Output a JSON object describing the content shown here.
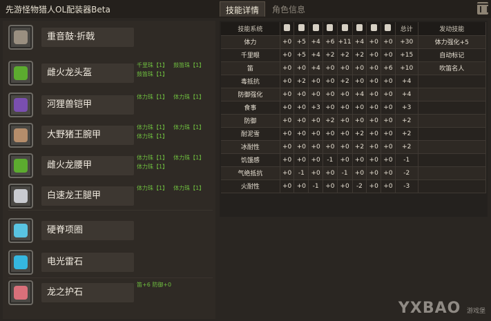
{
  "app": {
    "title": "先游怪物猎人OL配装器Beta"
  },
  "tabs": [
    {
      "label": "技能详情",
      "active": true
    },
    {
      "label": "角色信息",
      "active": false
    }
  ],
  "equipment": [
    {
      "name": "重音鼓·折戟",
      "icon": "weapon-drum-icon",
      "color": "#9a8f80",
      "decorations": []
    },
    {
      "name": "雌火龙头盔",
      "icon": "helm-icon",
      "color": "#5cab2f",
      "decorations": [
        "千里珠【1】",
        "鼓笛珠【1】",
        "鼓笛珠【1】"
      ]
    },
    {
      "name": "河狸兽铠甲",
      "icon": "chest-armor-icon",
      "color": "#7a4fb0",
      "decorations": [
        "体力珠【1】",
        "体力珠【1】"
      ]
    },
    {
      "name": "大野猪王腕甲",
      "icon": "gauntlet-icon",
      "color": "#b58d6b",
      "decorations": [
        "体力珠【1】",
        "体力珠【1】",
        "体力珠【1】"
      ]
    },
    {
      "name": "雌火龙腰甲",
      "icon": "waist-armor-icon",
      "color": "#5cab2f",
      "decorations": [
        "体力珠【1】",
        "体力珠【1】",
        "体力珠【1】"
      ]
    },
    {
      "name": "白速龙王腿甲",
      "icon": "leg-armor-icon",
      "color": "#c9cbd0",
      "decorations": [
        "体力珠【1】",
        "体力珠【1】"
      ]
    },
    {
      "name": "硬脊项圈",
      "icon": "necklace-icon",
      "color": "#59c4e2",
      "decorations": []
    },
    {
      "name": "电光雷石",
      "icon": "gem-icon",
      "color": "#35b7e0",
      "decorations": []
    },
    {
      "name": "龙之护石",
      "icon": "charm-icon",
      "color": "#d9707a",
      "decorations": [
        "笛+6  防御+0"
      ]
    }
  ],
  "table": {
    "header_first": "技能系统",
    "part_icons": [
      "weapon-icon",
      "helm-icon",
      "chest-icon",
      "arm-icon",
      "waist-icon",
      "leg-icon",
      "necklace-icon",
      "charm-icon"
    ],
    "header_total": "总计",
    "header_active": "发动技能",
    "rows": [
      {
        "name": "体力",
        "values": [
          "+0",
          "+5",
          "+4",
          "+6",
          "+11",
          "+4",
          "+0",
          "+0"
        ],
        "total": "+30",
        "active": "体力强化+5"
      },
      {
        "name": "千里眼",
        "values": [
          "+0",
          "+5",
          "+4",
          "+2",
          "+2",
          "+2",
          "+0",
          "+0"
        ],
        "total": "+15",
        "active": "自动标记"
      },
      {
        "name": "笛",
        "values": [
          "+0",
          "+0",
          "+4",
          "+0",
          "+0",
          "+0",
          "+0",
          "+6"
        ],
        "total": "+10",
        "active": "吹笛名人"
      },
      {
        "name": "毒抵抗",
        "values": [
          "+0",
          "+2",
          "+0",
          "+0",
          "+2",
          "+0",
          "+0",
          "+0"
        ],
        "total": "+4",
        "active": ""
      },
      {
        "name": "防御强化",
        "values": [
          "+0",
          "+0",
          "+0",
          "+0",
          "+0",
          "+4",
          "+0",
          "+0"
        ],
        "total": "+4",
        "active": ""
      },
      {
        "name": "食事",
        "values": [
          "+0",
          "+0",
          "+3",
          "+0",
          "+0",
          "+0",
          "+0",
          "+0"
        ],
        "total": "+3",
        "active": ""
      },
      {
        "name": "防御",
        "values": [
          "+0",
          "+0",
          "+0",
          "+2",
          "+0",
          "+0",
          "+0",
          "+0"
        ],
        "total": "+2",
        "active": ""
      },
      {
        "name": "耐泥雪",
        "values": [
          "+0",
          "+0",
          "+0",
          "+0",
          "+0",
          "+2",
          "+0",
          "+0"
        ],
        "total": "+2",
        "active": ""
      },
      {
        "name": "冰耐性",
        "values": [
          "+0",
          "+0",
          "+0",
          "+0",
          "+0",
          "+2",
          "+0",
          "+0"
        ],
        "total": "+2",
        "active": ""
      },
      {
        "name": "饥饿感",
        "values": [
          "+0",
          "+0",
          "+0",
          "-1",
          "+0",
          "+0",
          "+0",
          "+0"
        ],
        "total": "-1",
        "active": ""
      },
      {
        "name": "气绝抵抗",
        "values": [
          "+0",
          "-1",
          "+0",
          "+0",
          "-1",
          "+0",
          "+0",
          "+0"
        ],
        "total": "-2",
        "active": ""
      },
      {
        "name": "火耐性",
        "values": [
          "+0",
          "+0",
          "-1",
          "+0",
          "+0",
          "-2",
          "+0",
          "+0"
        ],
        "total": "-3",
        "active": ""
      }
    ]
  },
  "watermark": {
    "text": "YXBAO",
    "sub": "游戏堡"
  }
}
